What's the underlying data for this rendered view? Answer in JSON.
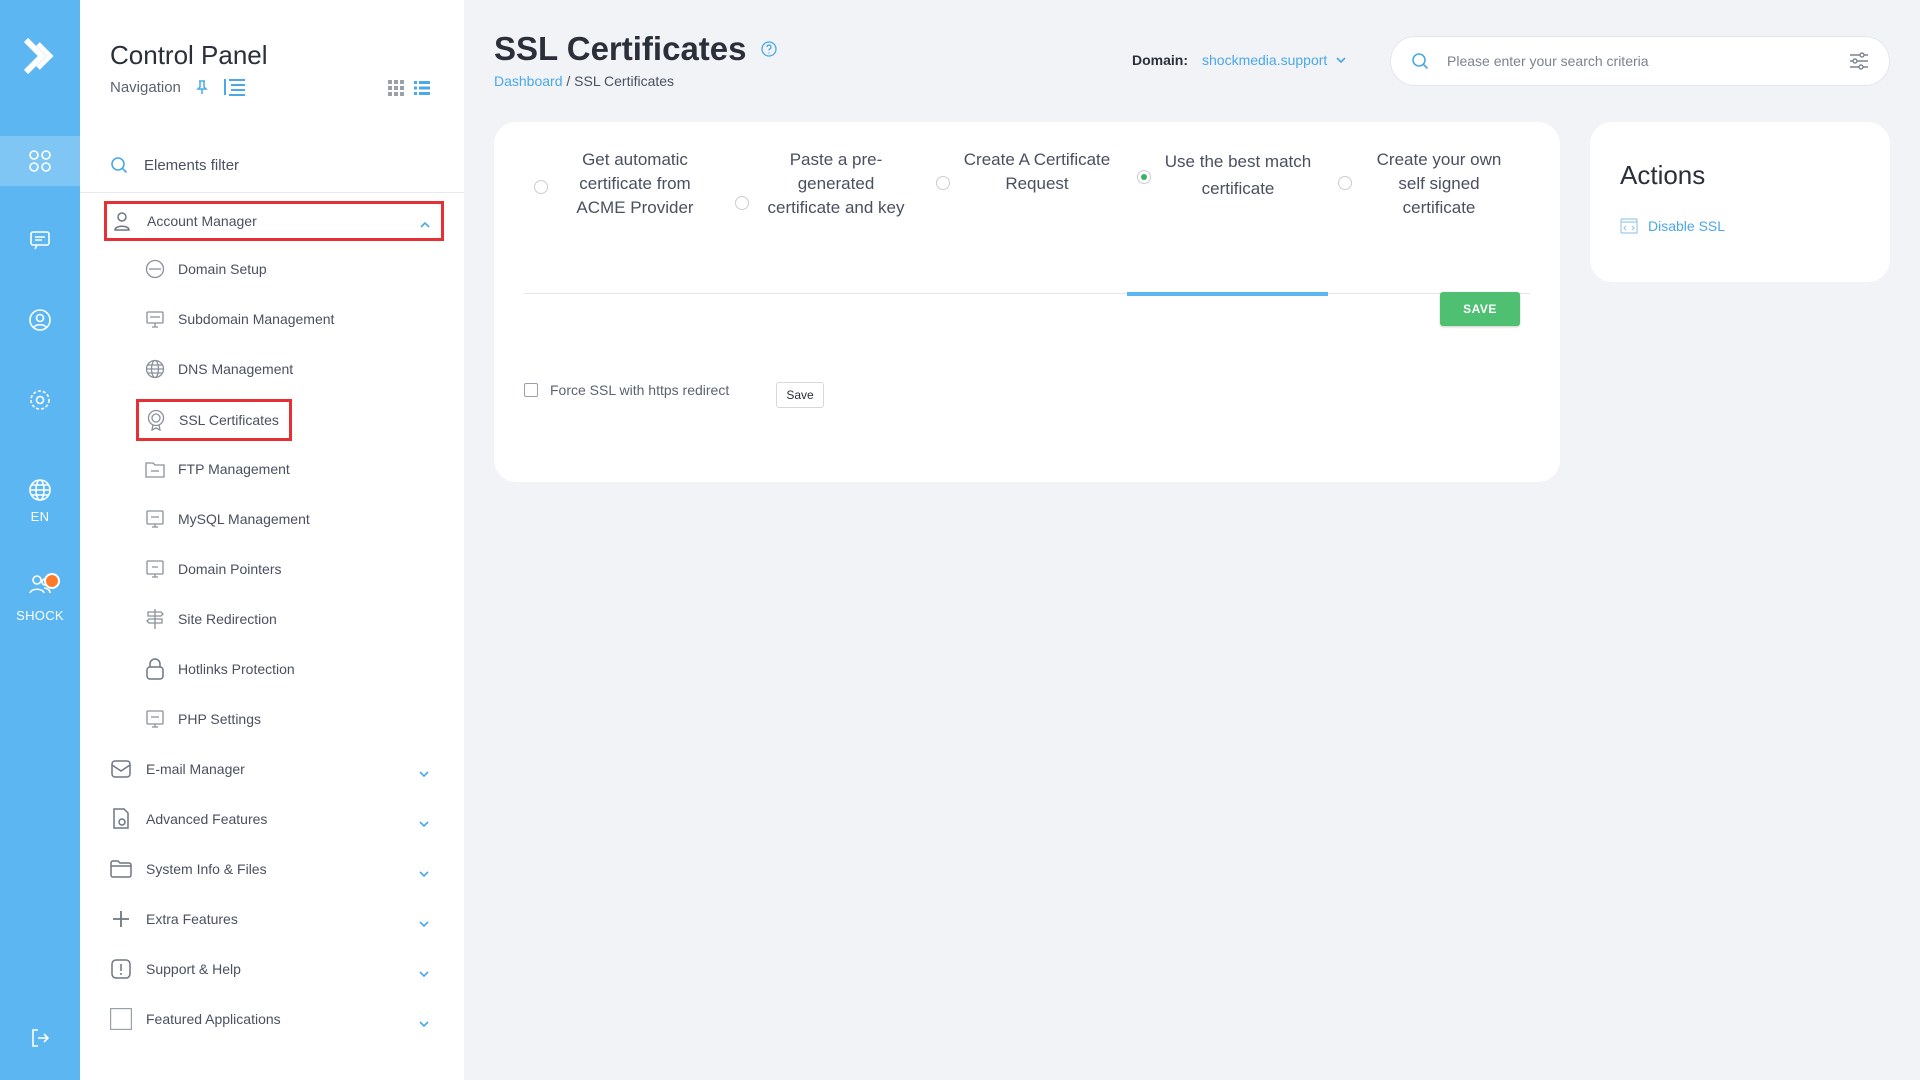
{
  "rail": {
    "language": "EN",
    "user": "SHOCK",
    "accent_color": "#5bb6f2"
  },
  "nav": {
    "title": "Control Panel",
    "subtitle": "Navigation",
    "filter_placeholder": "Elements filter",
    "account_manager": {
      "label": "Account Manager",
      "items": [
        {
          "label": "Domain Setup",
          "icon": "www-icon"
        },
        {
          "label": "Subdomain Management",
          "icon": "subdomain-icon"
        },
        {
          "label": "DNS Management",
          "icon": "dns-icon"
        },
        {
          "label": "SSL Certificates",
          "icon": "ssl-icon"
        },
        {
          "label": "FTP Management",
          "icon": "ftp-icon"
        },
        {
          "label": "MySQL Management",
          "icon": "sql-icon"
        },
        {
          "label": "Domain Pointers",
          "icon": "pointer-icon"
        },
        {
          "label": "Site Redirection",
          "icon": "signpost-icon"
        },
        {
          "label": "Hotlinks Protection",
          "icon": "lock-icon"
        },
        {
          "label": "PHP Settings",
          "icon": "php-icon"
        }
      ]
    },
    "sections": [
      {
        "label": "E-mail Manager",
        "icon": "mail-icon"
      },
      {
        "label": "Advanced Features",
        "icon": "gear-doc-icon"
      },
      {
        "label": "System Info & Files",
        "icon": "folder-icon"
      },
      {
        "label": "Extra Features",
        "icon": "plus-icon"
      },
      {
        "label": "Support & Help",
        "icon": "alert-icon"
      },
      {
        "label": "Featured Applications",
        "icon": "app-icon"
      }
    ]
  },
  "header": {
    "title": "SSL Certificates",
    "breadcrumb_home": "Dashboard",
    "breadcrumb_separator": " / ",
    "breadcrumb_current": "SSL Certificates",
    "domain_label": "Domain:",
    "domain_value": "shockmedia.support",
    "search_placeholder": "Please enter your search criteria"
  },
  "card": {
    "tabs": [
      {
        "label": "Get automatic certificate from ACME Provider",
        "selected": false
      },
      {
        "label": "Paste a pre-generated certificate and key",
        "selected": false
      },
      {
        "label": "Create A Certificate Request",
        "selected": false
      },
      {
        "label": "Use the best match certificate",
        "selected": true
      },
      {
        "label": "Create your own self signed certificate",
        "selected": false
      }
    ],
    "save_label": "SAVE",
    "force_ssl_label": "Force SSL with https redirect",
    "force_ssl_checked": false,
    "force_save_label": "Save",
    "save_color": "#4fbf72"
  },
  "actions": {
    "title": "Actions",
    "items": [
      {
        "label": "Disable SSL",
        "icon": "code-window-icon"
      }
    ]
  }
}
